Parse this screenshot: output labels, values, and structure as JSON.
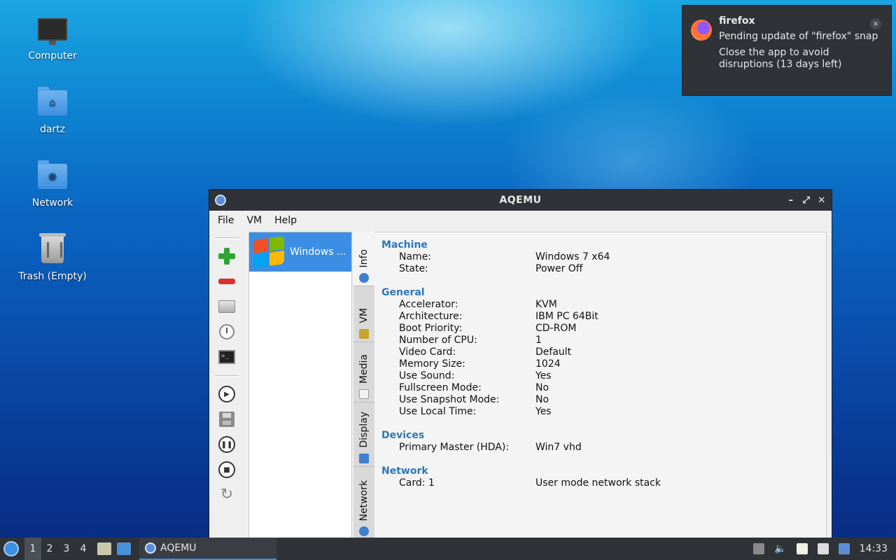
{
  "desktop": {
    "icons": [
      {
        "label": "Computer",
        "icon": "computer-icon"
      },
      {
        "label": "dartz",
        "icon": "home-folder-icon"
      },
      {
        "label": "Network",
        "icon": "network-folder-icon"
      },
      {
        "label": "Trash (Empty)",
        "icon": "trash-icon"
      }
    ]
  },
  "notification": {
    "app": "firefox",
    "line1": "Pending update of \"firefox\" snap",
    "line2": "Close the app to avoid disruptions (13 days left)",
    "close_glyph": "×"
  },
  "window": {
    "title": "AQEMU",
    "menu": [
      "File",
      "VM",
      "Help"
    ],
    "vm_list": [
      "Windows ..."
    ],
    "tabs": [
      "Info",
      "VM",
      "Media",
      "Display",
      "Network"
    ],
    "info": {
      "machine": {
        "title": "Machine",
        "rows": [
          [
            "Name:",
            "Windows 7 x64"
          ],
          [
            "State:",
            "Power Off"
          ]
        ]
      },
      "general": {
        "title": "General",
        "rows": [
          [
            "Accelerator:",
            "KVM"
          ],
          [
            "Architecture:",
            "IBM PC 64Bit"
          ],
          [
            "Boot Priority:",
            "CD-ROM"
          ],
          [
            "Number of CPU:",
            "1"
          ],
          [
            "Video Card:",
            "Default"
          ],
          [
            "Memory Size:",
            "1024"
          ],
          [
            "Use Sound:",
            "Yes"
          ],
          [
            "Fullscreen Mode:",
            "No"
          ],
          [
            "Use Snapshot Mode:",
            "No"
          ],
          [
            "Use Local Time:",
            "Yes"
          ]
        ]
      },
      "devices": {
        "title": "Devices",
        "rows": [
          [
            "Primary Master (HDA):",
            "Win7 vhd"
          ]
        ]
      },
      "network": {
        "title": "Network",
        "rows": [
          [
            "Card: 1",
            "User mode network stack"
          ]
        ]
      }
    }
  },
  "taskbar": {
    "workspaces": [
      "1",
      "2",
      "3",
      "4"
    ],
    "active_task": "AQEMU",
    "clock": "14:33"
  }
}
